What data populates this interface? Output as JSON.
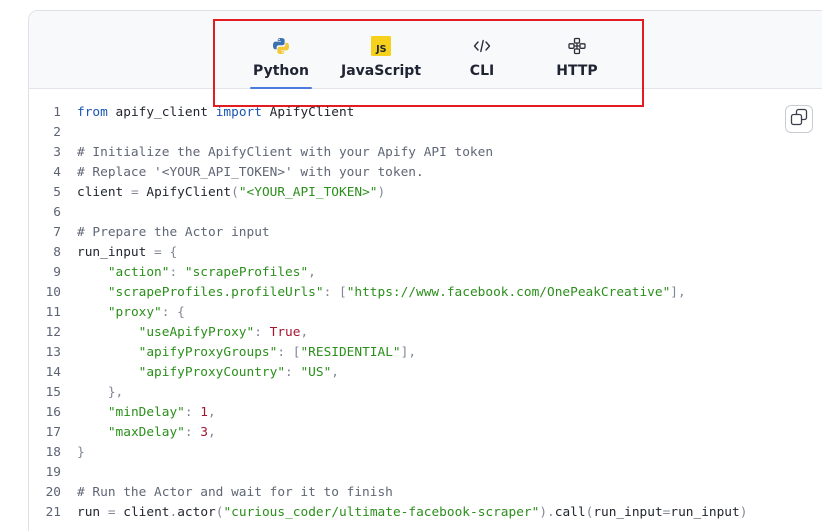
{
  "tabs": [
    {
      "label": "Python",
      "icon": "python-icon",
      "active": true
    },
    {
      "label": "JavaScript",
      "icon": "js-icon",
      "active": false
    },
    {
      "label": "CLI",
      "icon": "code-icon",
      "active": false
    },
    {
      "label": "HTTP",
      "icon": "network-icon",
      "active": false
    }
  ],
  "js_badge": "JS",
  "colors": {
    "accent": "#4a7bdd",
    "highlight": "#e31b23",
    "string": "#2b8f1c",
    "keyword": "#1a56b8"
  },
  "code_lines": [
    [
      {
        "t": "from",
        "c": "kw"
      },
      {
        "t": " apify_client "
      },
      {
        "t": "import",
        "c": "kw"
      },
      {
        "t": " ApifyClient"
      }
    ],
    [],
    [
      {
        "t": "# Initialize the ApifyClient with your Apify API token",
        "c": "cm"
      }
    ],
    [
      {
        "t": "# Replace '<YOUR_API_TOKEN>' with your token.",
        "c": "cm"
      }
    ],
    [
      {
        "t": "client "
      },
      {
        "t": "=",
        "c": "pn"
      },
      {
        "t": " ApifyClient"
      },
      {
        "t": "(",
        "c": "pn"
      },
      {
        "t": "\"<YOUR_API_TOKEN>\"",
        "c": "st"
      },
      {
        "t": ")",
        "c": "pn"
      }
    ],
    [],
    [
      {
        "t": "# Prepare the Actor input",
        "c": "cm"
      }
    ],
    [
      {
        "t": "run_input "
      },
      {
        "t": "=",
        "c": "pn"
      },
      {
        "t": " "
      },
      {
        "t": "{",
        "c": "pn"
      }
    ],
    [
      {
        "t": "    "
      },
      {
        "t": "\"action\"",
        "c": "st"
      },
      {
        "t": ": ",
        "c": "pn"
      },
      {
        "t": "\"scrapeProfiles\"",
        "c": "st"
      },
      {
        "t": ",",
        "c": "pn"
      }
    ],
    [
      {
        "t": "    "
      },
      {
        "t": "\"scrapeProfiles.profileUrls\"",
        "c": "st"
      },
      {
        "t": ": [",
        "c": "pn"
      },
      {
        "t": "\"https://www.facebook.com/OnePeakCreative\"",
        "c": "st"
      },
      {
        "t": "],",
        "c": "pn"
      }
    ],
    [
      {
        "t": "    "
      },
      {
        "t": "\"proxy\"",
        "c": "st"
      },
      {
        "t": ": {",
        "c": "pn"
      }
    ],
    [
      {
        "t": "        "
      },
      {
        "t": "\"useApifyProxy\"",
        "c": "st"
      },
      {
        "t": ": ",
        "c": "pn"
      },
      {
        "t": "True",
        "c": "nu"
      },
      {
        "t": ",",
        "c": "pn"
      }
    ],
    [
      {
        "t": "        "
      },
      {
        "t": "\"apifyProxyGroups\"",
        "c": "st"
      },
      {
        "t": ": [",
        "c": "pn"
      },
      {
        "t": "\"RESIDENTIAL\"",
        "c": "st"
      },
      {
        "t": "],",
        "c": "pn"
      }
    ],
    [
      {
        "t": "        "
      },
      {
        "t": "\"apifyProxyCountry\"",
        "c": "st"
      },
      {
        "t": ": ",
        "c": "pn"
      },
      {
        "t": "\"US\"",
        "c": "st"
      },
      {
        "t": ",",
        "c": "pn"
      }
    ],
    [
      {
        "t": "    "
      },
      {
        "t": "},",
        "c": "pn"
      }
    ],
    [
      {
        "t": "    "
      },
      {
        "t": "\"minDelay\"",
        "c": "st"
      },
      {
        "t": ": ",
        "c": "pn"
      },
      {
        "t": "1",
        "c": "nu"
      },
      {
        "t": ",",
        "c": "pn"
      }
    ],
    [
      {
        "t": "    "
      },
      {
        "t": "\"maxDelay\"",
        "c": "st"
      },
      {
        "t": ": ",
        "c": "pn"
      },
      {
        "t": "3",
        "c": "nu"
      },
      {
        "t": ",",
        "c": "pn"
      }
    ],
    [
      {
        "t": "}",
        "c": "pn"
      }
    ],
    [],
    [
      {
        "t": "# Run the Actor and wait for it to finish",
        "c": "cm"
      }
    ],
    [
      {
        "t": "run "
      },
      {
        "t": "=",
        "c": "pn"
      },
      {
        "t": " client"
      },
      {
        "t": ".",
        "c": "pn"
      },
      {
        "t": "actor"
      },
      {
        "t": "(",
        "c": "pn"
      },
      {
        "t": "\"curious_coder/ultimate-facebook-scraper\"",
        "c": "st"
      },
      {
        "t": ").",
        "c": "pn"
      },
      {
        "t": "call"
      },
      {
        "t": "(",
        "c": "pn"
      },
      {
        "t": "run_input"
      },
      {
        "t": "=",
        "c": "pn"
      },
      {
        "t": "run_input"
      },
      {
        "t": ")",
        "c": "pn"
      }
    ]
  ]
}
